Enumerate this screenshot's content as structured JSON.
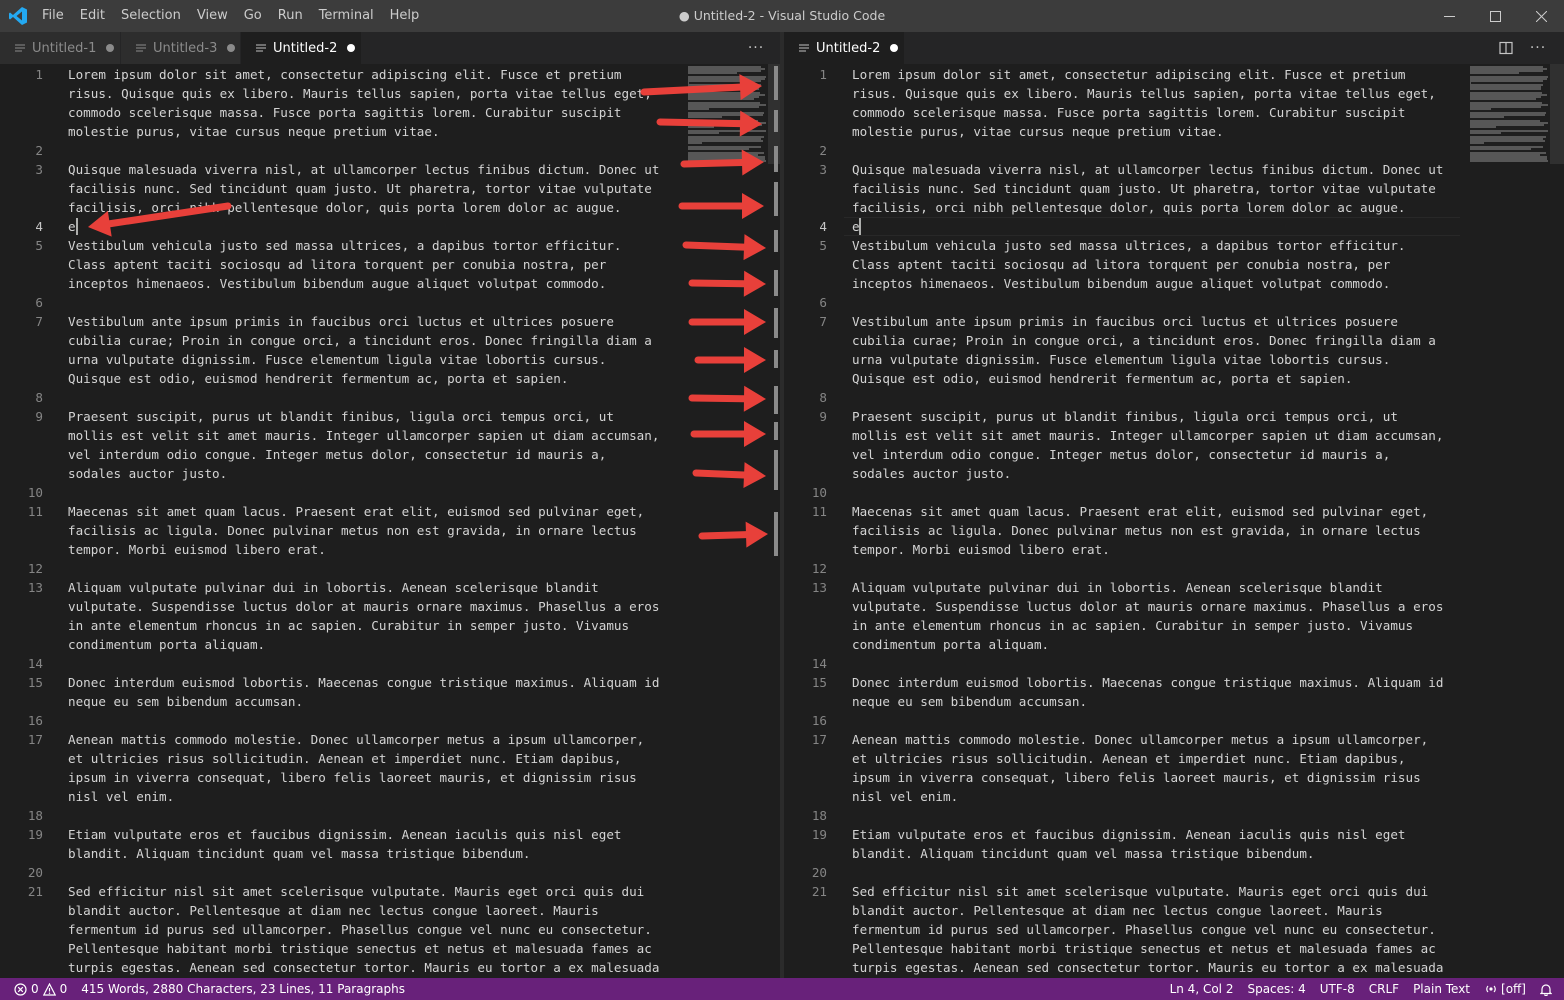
{
  "window": {
    "title": "● Untitled-2 - Visual Studio Code",
    "menu": [
      "File",
      "Edit",
      "Selection",
      "View",
      "Go",
      "Run",
      "Terminal",
      "Help"
    ],
    "icons": {
      "logo": "vscode-logo-icon",
      "minimize": "minimize-icon",
      "maximize": "maximize-icon",
      "close": "close-icon"
    }
  },
  "tabs_left": [
    {
      "label": "Untitled-1",
      "dirty": true,
      "active": false
    },
    {
      "label": "Untitled-3",
      "dirty": true,
      "active": false
    },
    {
      "label": "Untitled-2",
      "dirty": true,
      "active": true
    }
  ],
  "tabs_right": [
    {
      "label": "Untitled-2",
      "dirty": true,
      "active": true
    }
  ],
  "tab_actions": {
    "more_left": "more-actions-icon",
    "split": "split-editor-icon",
    "more_right": "more-actions-icon"
  },
  "editor": {
    "rows": [
      {
        "n": "1",
        "t": "Lorem ipsum dolor sit amet, consectetur adipiscing elit. Fusce et pretium"
      },
      {
        "n": "",
        "t": "risus. Quisque quis ex libero. Mauris tellus sapien, porta vitae tellus eget,"
      },
      {
        "n": "",
        "t": "commodo scelerisque massa. Fusce porta sagittis lorem. Curabitur suscipit"
      },
      {
        "n": "",
        "t": "molestie purus, vitae cursus neque pretium vitae."
      },
      {
        "n": "2",
        "t": ""
      },
      {
        "n": "3",
        "t": "Quisque malesuada viverra nisl, at ullamcorper lectus finibus dictum. Donec ut"
      },
      {
        "n": "",
        "t": "facilisis nunc. Sed tincidunt quam justo. Ut pharetra, tortor vitae vulputate"
      },
      {
        "n": "",
        "t": "facilisis, orci nibh pellentesque dolor, quis porta lorem dolor ac augue."
      },
      {
        "n": "4",
        "t": "e"
      },
      {
        "n": "5",
        "t": "Vestibulum vehicula justo sed massa ultrices, a dapibus tortor efficitur."
      },
      {
        "n": "",
        "t": "Class aptent taciti sociosqu ad litora torquent per conubia nostra, per"
      },
      {
        "n": "",
        "t": "inceptos himenaeos. Vestibulum bibendum augue aliquet volutpat commodo."
      },
      {
        "n": "6",
        "t": ""
      },
      {
        "n": "7",
        "t": "Vestibulum ante ipsum primis in faucibus orci luctus et ultrices posuere"
      },
      {
        "n": "",
        "t": "cubilia curae; Proin in congue orci, a tincidunt eros. Donec fringilla diam a"
      },
      {
        "n": "",
        "t": "urna vulputate dignissim. Fusce elementum ligula vitae lobortis cursus."
      },
      {
        "n": "",
        "t": "Quisque est odio, euismod hendrerit fermentum ac, porta et sapien."
      },
      {
        "n": "8",
        "t": ""
      },
      {
        "n": "9",
        "t": "Praesent suscipit, purus ut blandit finibus, ligula orci tempus orci, ut"
      },
      {
        "n": "",
        "t": "mollis est velit sit amet mauris. Integer ullamcorper sapien ut diam accumsan,"
      },
      {
        "n": "",
        "t": "vel interdum odio congue. Integer metus dolor, consectetur id mauris a,"
      },
      {
        "n": "",
        "t": "sodales auctor justo."
      },
      {
        "n": "10",
        "t": ""
      },
      {
        "n": "11",
        "t": "Maecenas sit amet quam lacus. Praesent erat elit, euismod sed pulvinar eget,"
      },
      {
        "n": "",
        "t": "facilisis ac ligula. Donec pulvinar metus non est gravida, in ornare lectus"
      },
      {
        "n": "",
        "t": "tempor. Morbi euismod libero erat."
      },
      {
        "n": "12",
        "t": ""
      },
      {
        "n": "13",
        "t": "Aliquam vulputate pulvinar dui in lobortis. Aenean scelerisque blandit"
      },
      {
        "n": "",
        "t": "vulputate. Suspendisse luctus dolor at mauris ornare maximus. Phasellus a eros"
      },
      {
        "n": "",
        "t": "in ante elementum rhoncus in ac sapien. Curabitur in semper justo. Vivamus"
      },
      {
        "n": "",
        "t": "condimentum porta aliquam."
      },
      {
        "n": "14",
        "t": ""
      },
      {
        "n": "15",
        "t": "Donec interdum euismod lobortis. Maecenas congue tristique maximus. Aliquam id"
      },
      {
        "n": "",
        "t": "neque eu sem bibendum accumsan."
      },
      {
        "n": "16",
        "t": ""
      },
      {
        "n": "17",
        "t": "Aenean mattis commodo molestie. Donec ullamcorper metus a ipsum ullamcorper,"
      },
      {
        "n": "",
        "t": "et ultricies risus sollicitudin. Aenean et imperdiet nunc. Etiam dapibus,"
      },
      {
        "n": "",
        "t": "ipsum in viverra consequat, libero felis laoreet mauris, et dignissim risus"
      },
      {
        "n": "",
        "t": "nisl vel enim."
      },
      {
        "n": "18",
        "t": ""
      },
      {
        "n": "19",
        "t": "Etiam vulputate eros et faucibus dignissim. Aenean iaculis quis nisl eget"
      },
      {
        "n": "",
        "t": "blandit. Aliquam tincidunt quam vel massa tristique bibendum."
      },
      {
        "n": "20",
        "t": ""
      },
      {
        "n": "21",
        "t": "Sed efficitur nisl sit amet scelerisque vulputate. Mauris eget orci quis dui"
      },
      {
        "n": "",
        "t": "blandit auctor. Pellentesque at diam nec lectus congue laoreet. Mauris"
      },
      {
        "n": "",
        "t": "fermentum id purus sed ullamcorper. Phasellus congue vel nunc eu consectetur."
      },
      {
        "n": "",
        "t": "Pellentesque habitant morbi tristique senectus et netus et malesuada fames ac"
      },
      {
        "n": "",
        "t": "turpis egestas. Aenean sed consectetur tortor. Mauris eu tortor a ex malesuada"
      }
    ],
    "current_line": "4"
  },
  "statusbar": {
    "errors": "0",
    "warnings": "0",
    "word_count": "415 Words, 2880 Characters, 23 Lines, 11 Paragraphs",
    "cursor_pos": "Ln 4, Col 2",
    "indent": "Spaces: 4",
    "encoding": "UTF-8",
    "eol": "CRLF",
    "language": "Plain Text",
    "live_share": "[off]",
    "icons": {
      "errors": "error-icon",
      "warnings": "warning-icon",
      "live_share": "broadcast-icon",
      "notifications": "bell-icon"
    }
  },
  "colors": {
    "statusbar": "#68217a",
    "annotation_arrow": "#e8403a",
    "editor_bg": "#1e1e1e",
    "titlebar": "#3c3c3c"
  }
}
